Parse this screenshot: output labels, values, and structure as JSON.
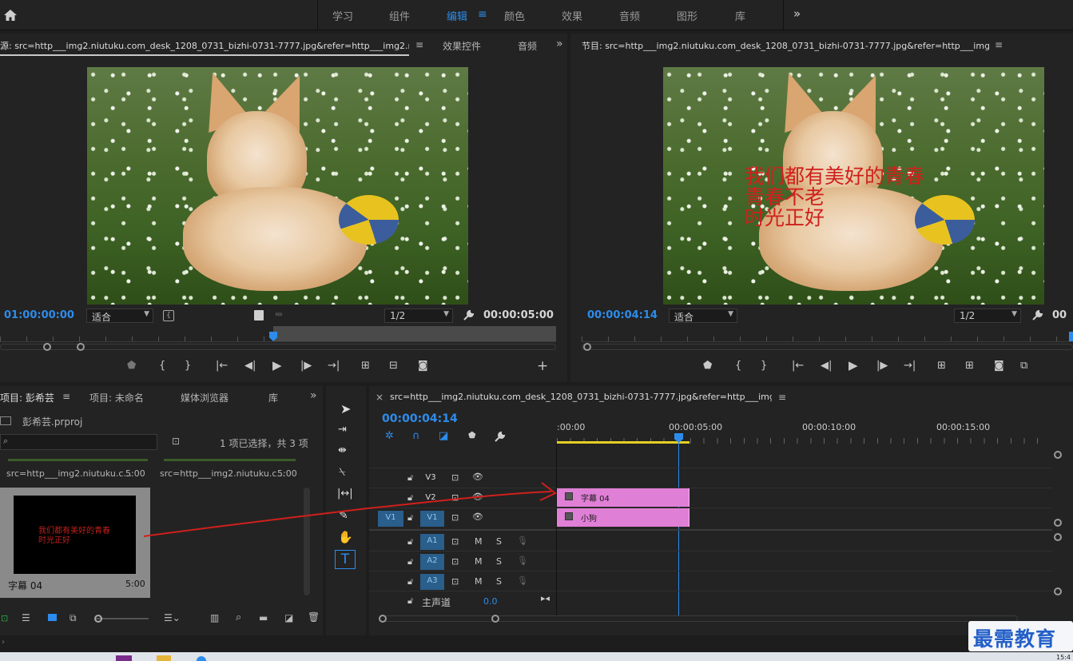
{
  "top": {
    "workspaces": [
      {
        "label": "学习"
      },
      {
        "label": "组件"
      },
      {
        "label": "编辑"
      },
      {
        "label": "颜色"
      },
      {
        "label": "效果"
      },
      {
        "label": "音频"
      },
      {
        "label": "图形"
      },
      {
        "label": "库"
      }
    ],
    "more": "»"
  },
  "source": {
    "tab": "源: src=http___img2.niutuku.com_desk_1208_0731_bizhi-0731-7777.jpg&refer=http___img2.niutuku.jpg",
    "tab_menu": "≡",
    "tab2": "效果控件",
    "tab3": "音频",
    "more": "»",
    "timecode_in": "01:00:00:00",
    "fit": "适合",
    "res": "1/2",
    "timecode_out": "00:00:05:00"
  },
  "program": {
    "tab": "节目: src=http___img2.niutuku.com_desk_1208_0731_bizhi-0731-7777.jpg&refer=http___img2.niutuku",
    "tab_menu": "≡",
    "timecode": "00:00:04:14",
    "fit": "适合",
    "res": "1/2",
    "overlay": [
      "我们都有美好的青春",
      "青春不老",
      "时光正好"
    ],
    "timecode_out": "00"
  },
  "project": {
    "tabs": [
      "项目: 彭希芸",
      "项目: 未命名",
      "媒体浏览器",
      "库"
    ],
    "tab_menu": "≡",
    "more": "»",
    "file": "彭希芸.prproj",
    "selection": "1 项已选择，共 3 项",
    "bins": [
      {
        "name": "src=http___img2.niutuku.c...",
        "dur": "5:00"
      },
      {
        "name": "src=http___img2.niutuku.c...",
        "dur": "5:00"
      }
    ],
    "title_item": {
      "name": "字幕 04",
      "dur": "5:00",
      "thumb_text": [
        "我们都有美好的青春",
        "时光正好"
      ]
    }
  },
  "timeline": {
    "close": "×",
    "tab": "src=http___img2.niutuku.com_desk_1208_0731_bizhi-0731-7777.jpg&refer=http___img2.niutuku",
    "tab_menu": "≡",
    "timecode": "00:00:04:14",
    "ruler": [
      ":00:00",
      "00:00:05:00",
      "00:00:10:00",
      "00:00:15:00"
    ],
    "video_tracks": [
      "V3",
      "V2",
      "V1"
    ],
    "src_patch": "V1",
    "audio_tracks": [
      "A1",
      "A2",
      "A3"
    ],
    "m": "M",
    "s": "S",
    "master": "主声道",
    "master_val": "0.0",
    "clips": [
      {
        "label": "字幕 04"
      },
      {
        "label": "小狗"
      }
    ]
  },
  "watermark": {
    "text": "最需教育"
  },
  "taskbar": {
    "clock": "15:4"
  }
}
